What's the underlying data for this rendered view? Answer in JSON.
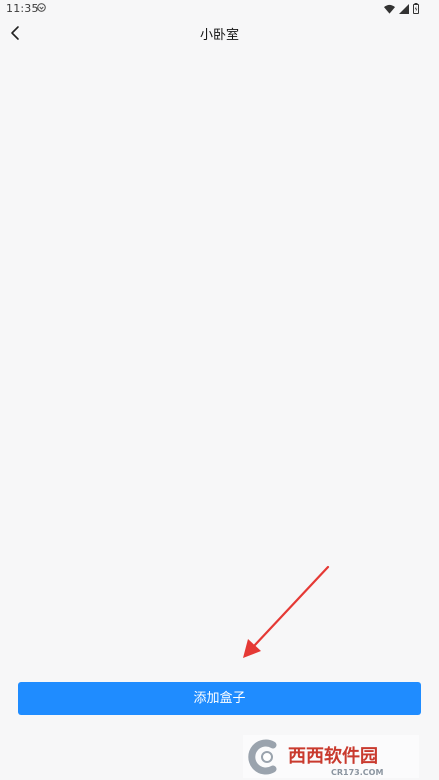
{
  "status_bar": {
    "time": "11:35",
    "notification_icon": "shield-icon",
    "wifi_icon": "wifi-icon",
    "signal_icon": "signal-icon",
    "battery_icon": "battery-icon"
  },
  "header": {
    "back_icon": "chevron-left-icon",
    "title": "小卧室"
  },
  "main": {
    "add_button_label": "添加盒子"
  },
  "watermark": {
    "brand": "西西软件园",
    "url": "CR173.COM"
  },
  "colors": {
    "background": "#f7f7f8",
    "primary_button": "#1f8cff",
    "annotation_arrow": "#e53935"
  }
}
